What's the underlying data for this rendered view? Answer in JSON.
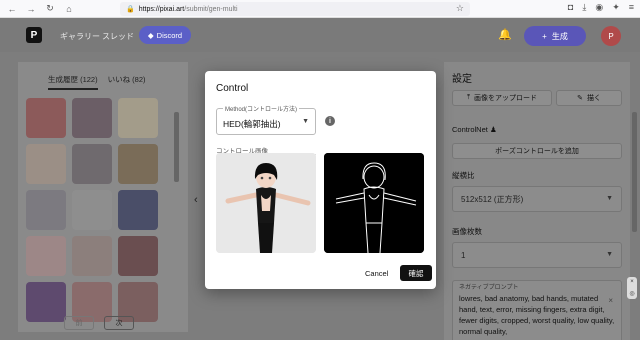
{
  "browser": {
    "url_host": "https://pixai.art",
    "url_path": "/submit/gen-multi"
  },
  "header": {
    "nav": [
      "ギャラリー",
      "スレッド"
    ],
    "discord_label": "Discord",
    "generate_label": "生成",
    "avatar_initial": "P"
  },
  "left": {
    "tabs": [
      {
        "label": "生成履歴 (122)"
      },
      {
        "label": "いいね (82)"
      }
    ],
    "prev_label": "前",
    "next_label": "次"
  },
  "right": {
    "title": "設定",
    "upload_label": "画像をアップロード",
    "draw_label": "描く",
    "controlnet_label": "ControlNet",
    "pose_label": "ポーズコントロールを追加",
    "aspect_label": "縦横比",
    "aspect_value": "512x512 (正方形)",
    "count_label": "画像枚数",
    "count_value": "1",
    "negative_label": "ネガティブプロンプト",
    "negative_text": "lowres, bad anatomy, bad hands, mutated hand, text, error, missing fingers, extra digit, fewer digits, cropped, worst quality, low quality, normal quality,"
  },
  "modal": {
    "title": "Control",
    "method_legend": "Method(コントロール方法)",
    "method_value": "HED(輪郭抽出)",
    "control_image_label": "コントロール画像",
    "cancel_label": "Cancel",
    "confirm_label": "確認"
  },
  "colors": {
    "accent": "#5a56b8",
    "discord": "#5b5fc7"
  }
}
